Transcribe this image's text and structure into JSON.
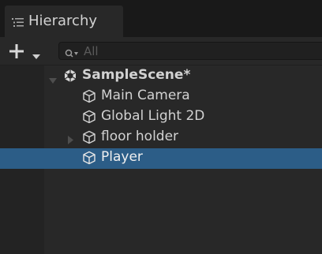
{
  "tab": {
    "title": "Hierarchy",
    "icon": "hierarchy-list-icon"
  },
  "toolbar": {
    "add_icon": "plus-icon",
    "dropdown_icon": "caret-down-icon",
    "search": {
      "placeholder": "All",
      "icon": "search-filter-icon"
    }
  },
  "scene": {
    "name": "SampleScene*",
    "expanded": true,
    "icon": "unity-scene-icon"
  },
  "objects": [
    {
      "name": "Main Camera",
      "icon": "gameobject-cube-icon",
      "has_children": false,
      "selected": false
    },
    {
      "name": "Global Light 2D",
      "icon": "gameobject-cube-icon",
      "has_children": false,
      "selected": false
    },
    {
      "name": "floor holder",
      "icon": "gameobject-cube-icon",
      "has_children": true,
      "expanded": false,
      "selected": false
    },
    {
      "name": "Player",
      "icon": "gameobject-cube-icon",
      "has_children": false,
      "selected": true
    }
  ],
  "colors": {
    "panel": "#282828",
    "selection": "#2c5d87",
    "text": "#d2d2d2",
    "placeholder": "#5a5a5a"
  }
}
